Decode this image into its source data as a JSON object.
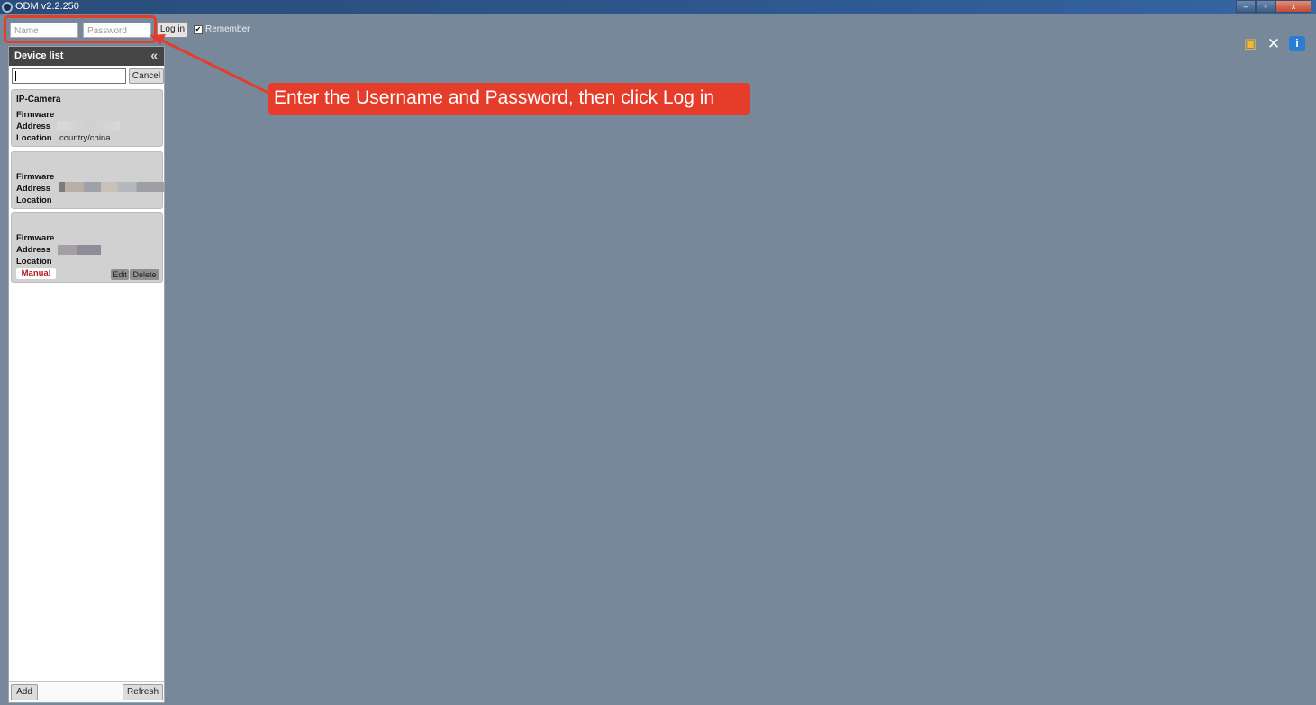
{
  "window": {
    "title": "ODM v2.2.250",
    "min": "–",
    "max": "▫",
    "close": "x"
  },
  "login": {
    "name_placeholder": "Name",
    "password_placeholder": "Password",
    "login_label": "Log in",
    "remember_label": "Remember",
    "remember_checked": true
  },
  "toolbar_icons": [
    "camera-settings-icon",
    "tools-icon",
    "info-icon"
  ],
  "callout": {
    "text": "Enter the Username and Password, then click Log in",
    "color": "#e53d2a"
  },
  "device_list": {
    "title": "Device list",
    "collapse_glyph": "«",
    "cancel_label": "Cancel",
    "labels": {
      "firmware": "Firmware",
      "address": "Address",
      "location": "Location"
    },
    "devices": [
      {
        "name": "IP-Camera",
        "location": "country/china"
      },
      {
        "name": "",
        "location": ""
      },
      {
        "name": "",
        "location": "",
        "badge": "Manual",
        "edit_label": "Edit",
        "delete_label": "Delete"
      }
    ],
    "add_label": "Add",
    "refresh_label": "Refresh"
  },
  "colors": {
    "workspace": "#76889a",
    "accent": "#e53d2a",
    "header": "#454545"
  }
}
